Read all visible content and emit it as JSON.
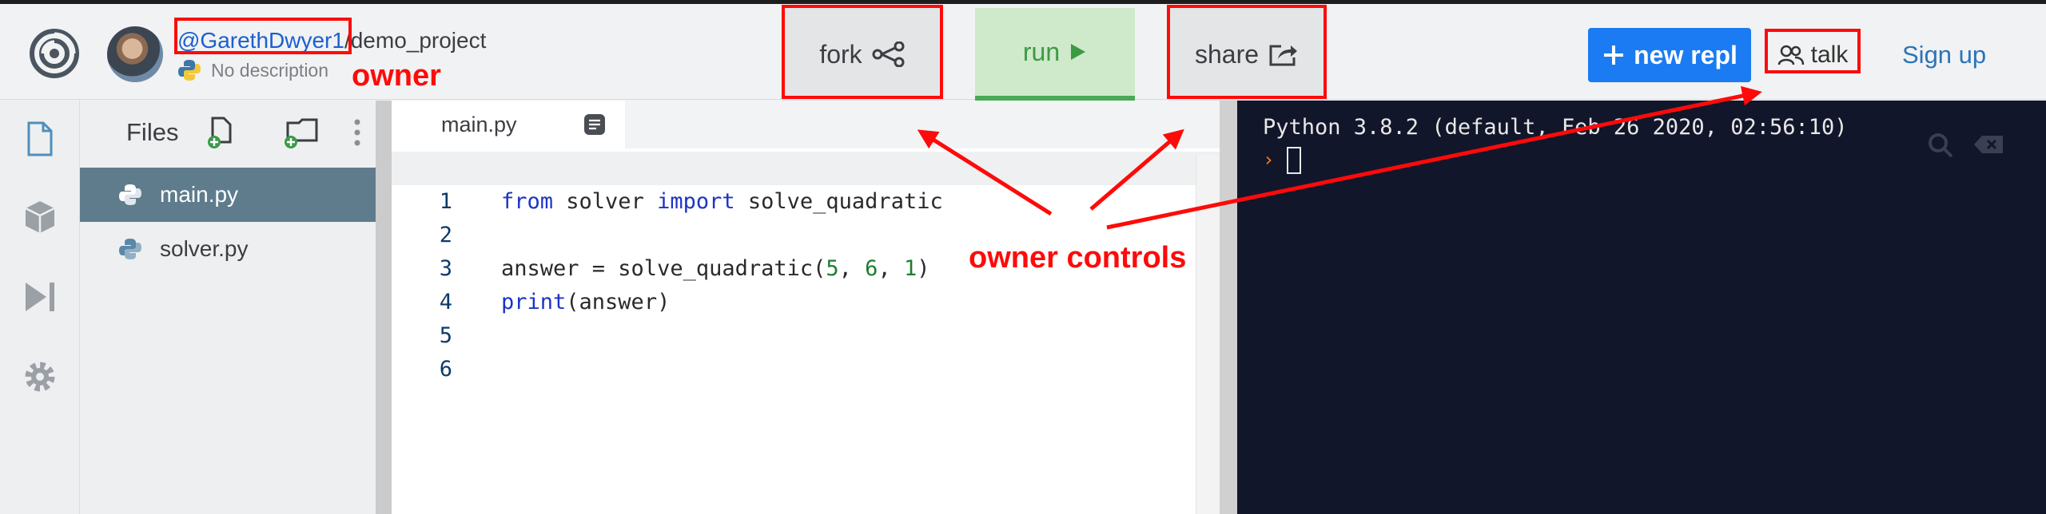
{
  "header": {
    "owner_handle": "@GarethDwyer1",
    "separator": "/",
    "project_name": "demo_project",
    "description": "No description",
    "fork_label": "fork",
    "run_label": "run",
    "share_label": "share",
    "new_repl_label": "new repl",
    "talk_label": "talk",
    "signup_label": "Sign up"
  },
  "files": {
    "title": "Files",
    "items": [
      {
        "name": "main.py",
        "active": true
      },
      {
        "name": "solver.py",
        "active": false
      }
    ]
  },
  "editor": {
    "tab_label": "main.py",
    "line_numbers": [
      "1",
      "2",
      "3",
      "4",
      "5",
      "6"
    ]
  },
  "console": {
    "banner": "Python 3.8.2 (default, Feb 26 2020, 02:56:10)",
    "prompt": "›"
  },
  "annotations": {
    "owner_label": "owner",
    "controls_label": "owner controls",
    "color": "#ff0a0a"
  },
  "colors": {
    "run_green": "#3c9a43",
    "new_repl_blue": "#1a7bf2",
    "console_bg": "#12162a",
    "active_file_bg": "#5f7c8d"
  }
}
